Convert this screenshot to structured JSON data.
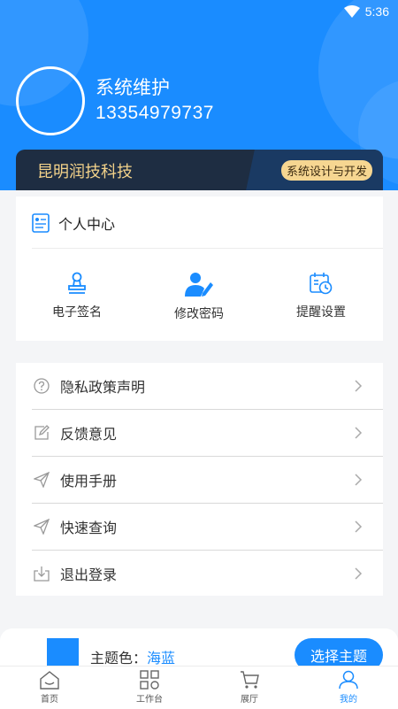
{
  "status_bar": {
    "time": "5:36",
    "wifi_icon": "wifi-icon"
  },
  "user": {
    "name": "系统维护",
    "phone": "13354979737"
  },
  "banner": {
    "company": "昆明润技科技",
    "badge": "系统设计与开发"
  },
  "personal_center": {
    "title": "个人中心",
    "quick_actions": [
      {
        "label": "电子签名",
        "icon": "stamp-icon"
      },
      {
        "label": "修改密码",
        "icon": "user-edit-icon"
      },
      {
        "label": "提醒设置",
        "icon": "calendar-clock-icon"
      }
    ]
  },
  "menu": [
    {
      "label": "隐私政策声明",
      "icon": "question-circle-icon"
    },
    {
      "label": "反馈意见",
      "icon": "edit-icon"
    },
    {
      "label": "使用手册",
      "icon": "send-icon"
    },
    {
      "label": "快速查询",
      "icon": "send-icon"
    },
    {
      "label": "退出登录",
      "icon": "download-icon"
    }
  ],
  "theme": {
    "label": "主题色：",
    "value": "海蓝",
    "button": "选择主题",
    "color": "#1a8cff"
  },
  "tabs": [
    {
      "label": "首页",
      "icon": "home-icon",
      "active": false
    },
    {
      "label": "工作台",
      "icon": "grid-icon",
      "active": false
    },
    {
      "label": "展厅",
      "icon": "cart-icon",
      "active": false
    },
    {
      "label": "我的",
      "icon": "user-icon",
      "active": true
    }
  ],
  "colors": {
    "primary": "#1a8cff",
    "banner_bg": "#1e2d42",
    "gold": "#f3d28a"
  }
}
